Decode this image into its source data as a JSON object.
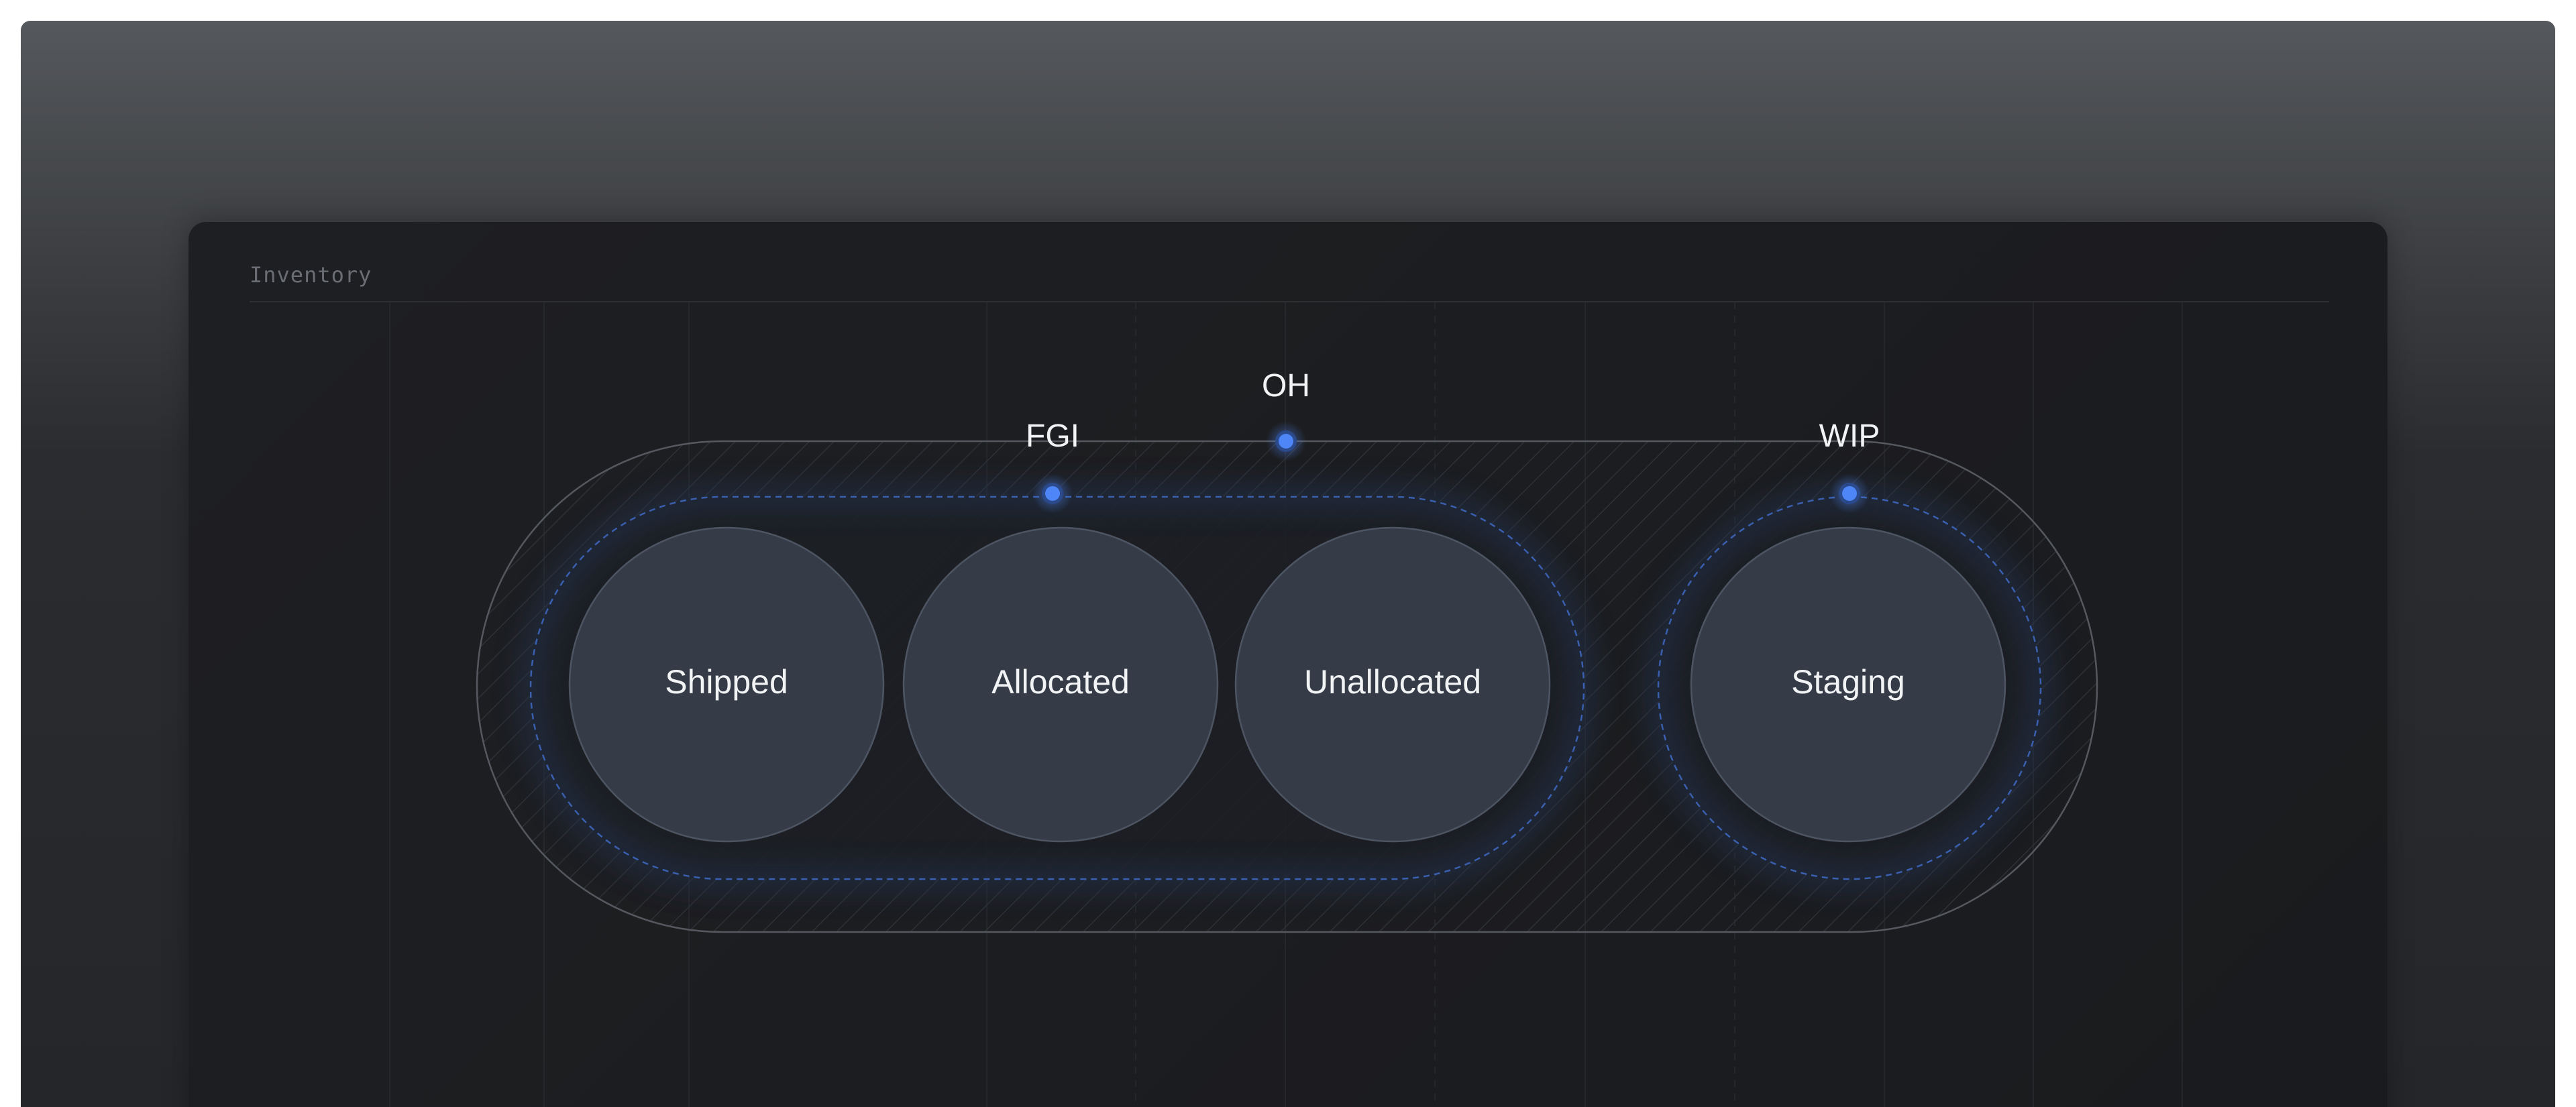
{
  "panel": {
    "title": "Inventory"
  },
  "groups": {
    "outer": {
      "label": "OH"
    },
    "left": {
      "label": "FGI"
    },
    "right": {
      "label": "WIP"
    }
  },
  "nodes": [
    {
      "label": "Shipped"
    },
    {
      "label": "Allocated"
    },
    {
      "label": "Unallocated"
    },
    {
      "label": "Staging"
    }
  ],
  "colors": {
    "accent": "#4f86f7",
    "node_fill": "#353c47",
    "group_stroke": "#3a5fae"
  }
}
